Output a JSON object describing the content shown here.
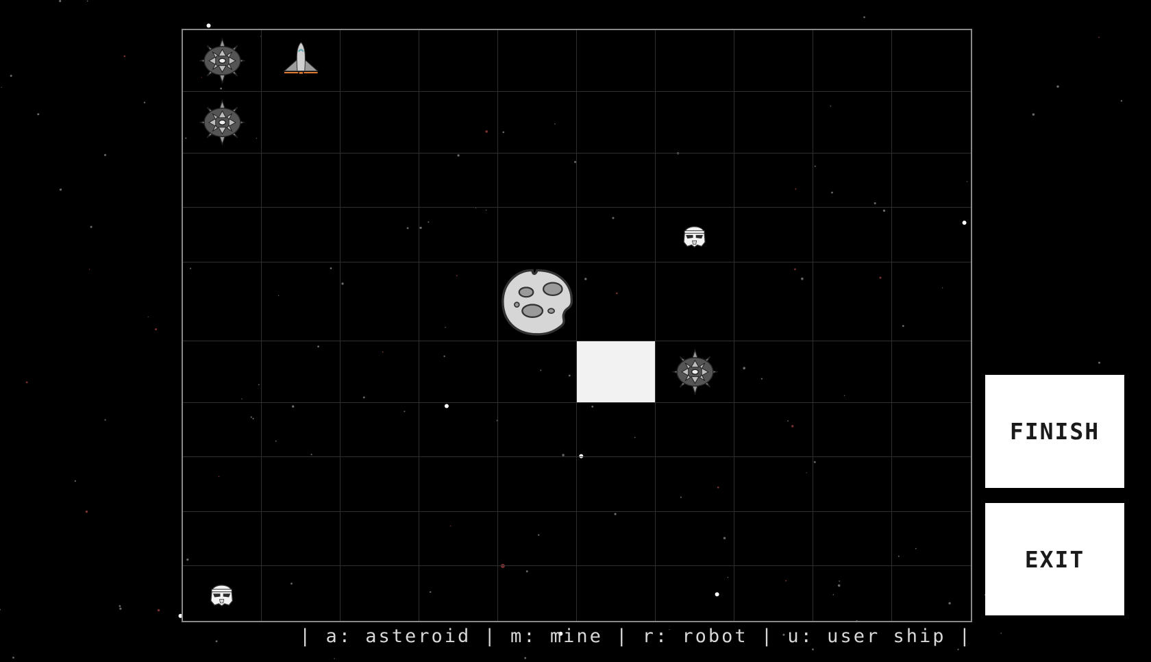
{
  "board": {
    "rows": 10,
    "cols": 10,
    "selected_cell": {
      "row": 5,
      "col": 5
    },
    "entities": [
      {
        "type": "mine",
        "row": 0,
        "col": 0
      },
      {
        "type": "user_ship",
        "row": 0,
        "col": 1
      },
      {
        "type": "mine",
        "row": 1,
        "col": 0
      },
      {
        "type": "robot",
        "row": 3,
        "col": 6
      },
      {
        "type": "asteroid",
        "row": 4,
        "col": 4
      },
      {
        "type": "mine",
        "row": 5,
        "col": 6
      },
      {
        "type": "robot",
        "row": 9,
        "col": 0
      }
    ]
  },
  "buttons": {
    "finish_label": "FINISH",
    "exit_label": "EXIT"
  },
  "legend": {
    "text": "| a: asteroid | m: mine | r: robot | u: user ship |"
  },
  "icons": {
    "mine": "mine-icon",
    "user_ship": "spaceship-icon",
    "robot": "robot-helmet-icon",
    "asteroid": "asteroid-icon"
  },
  "colors": {
    "background": "#000000",
    "grid_line": "#2f2f2f",
    "board_border": "#8a8a8a",
    "selected_cell": "#f2f2f2",
    "button_bg": "#ffffff",
    "legend_text": "#d8d8d8"
  }
}
